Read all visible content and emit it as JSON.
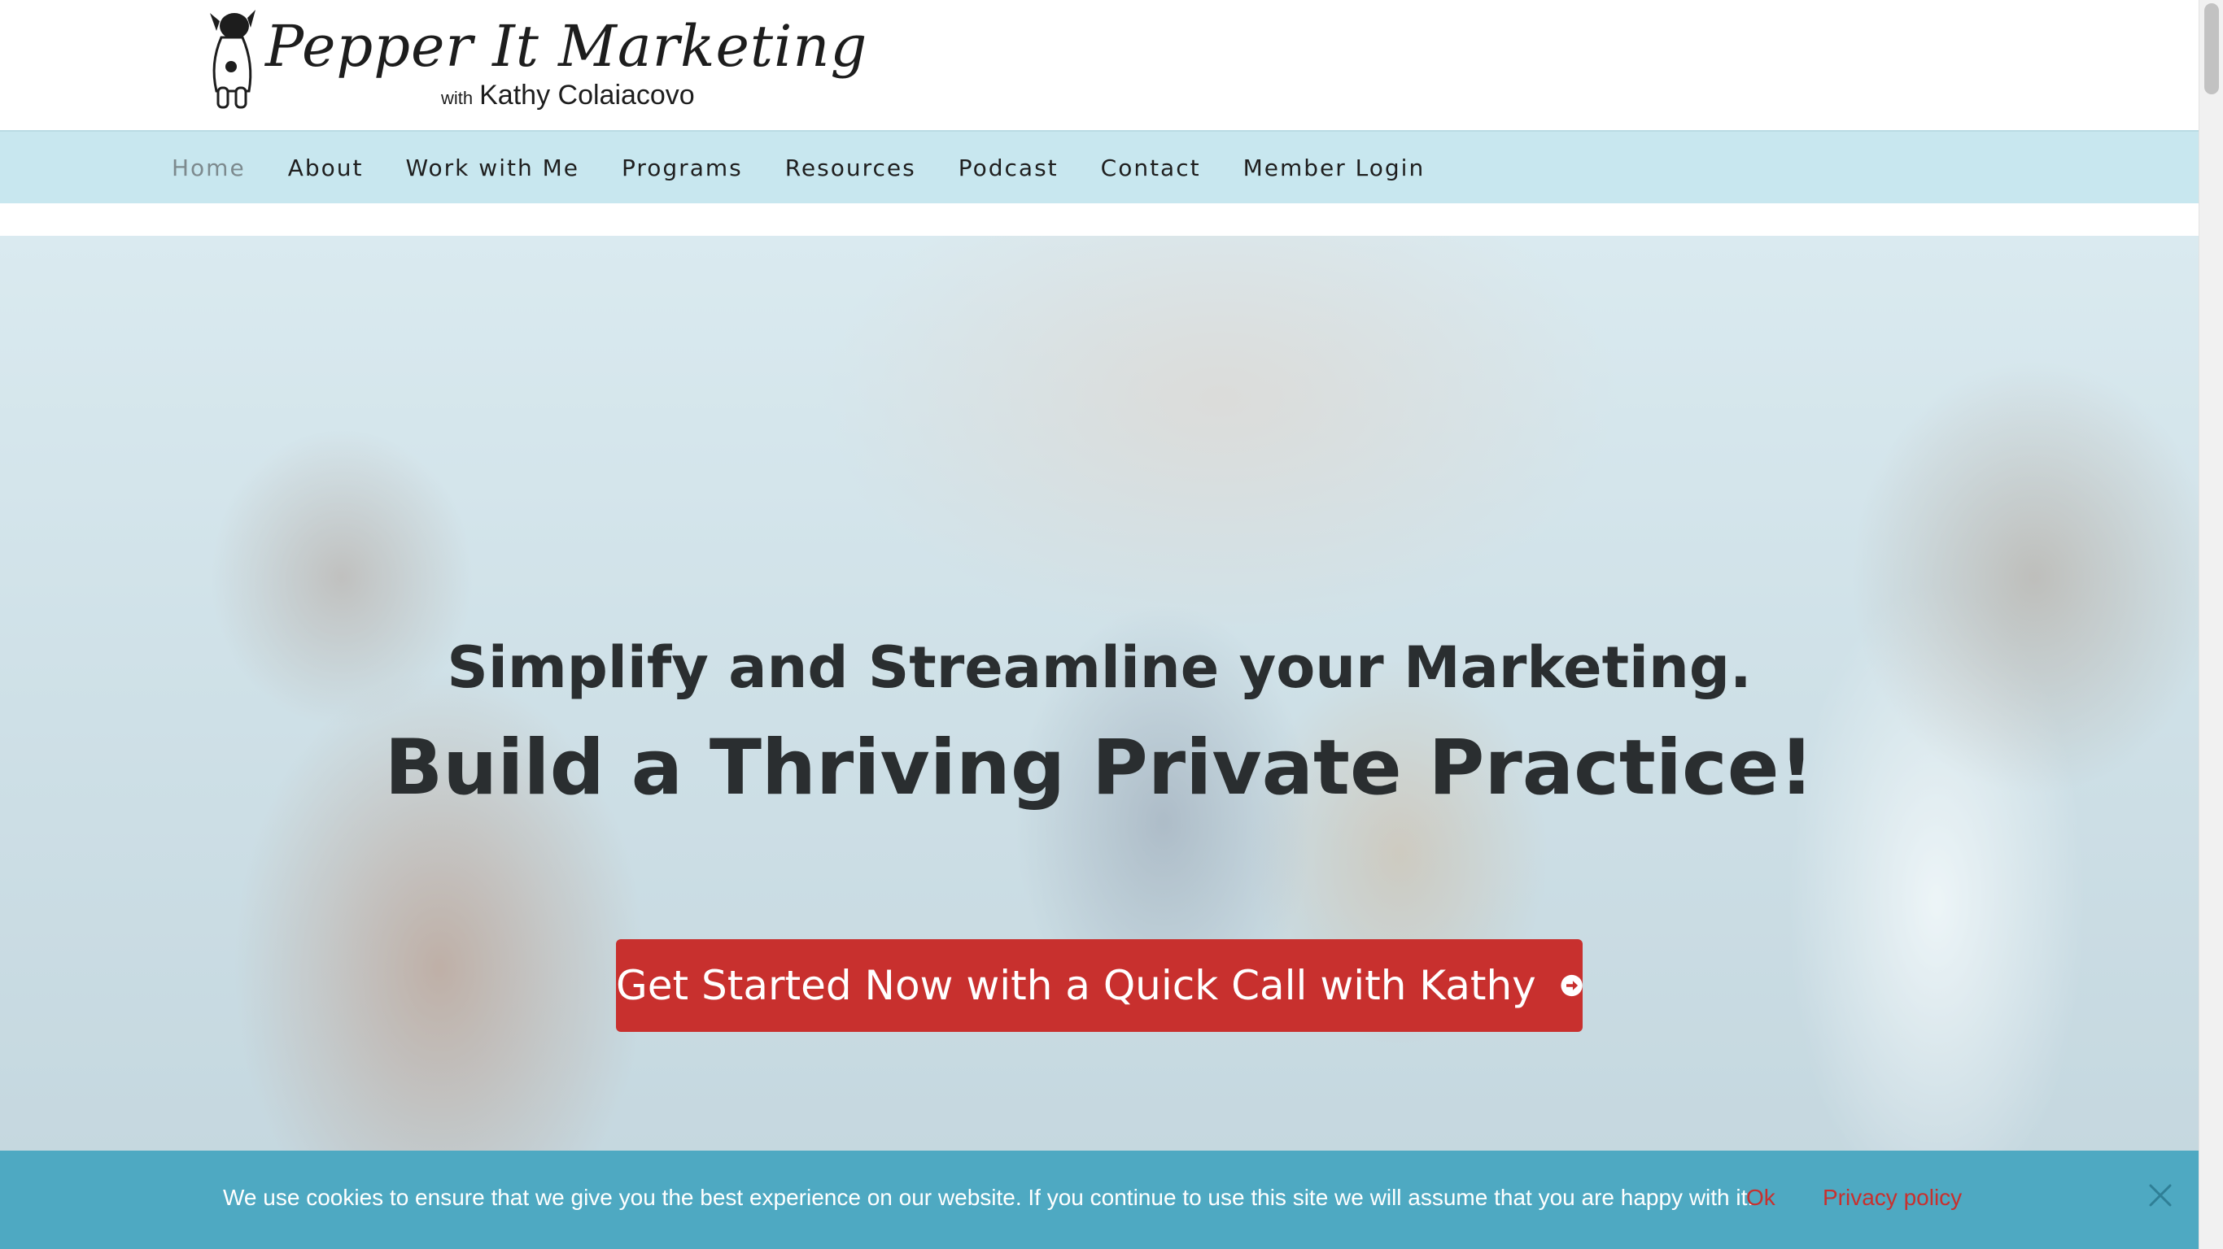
{
  "logo": {
    "script": "Pepper It Marketing",
    "with": "with",
    "name": "Kathy Colaiacovo",
    "icon": "dog-mascot-icon"
  },
  "nav": {
    "items": [
      {
        "label": "Home",
        "active": true
      },
      {
        "label": "About"
      },
      {
        "label": "Work with Me"
      },
      {
        "label": "Programs"
      },
      {
        "label": "Resources"
      },
      {
        "label": "Podcast"
      },
      {
        "label": "Contact"
      },
      {
        "label": "Member Login"
      }
    ]
  },
  "hero": {
    "headline": "Simplify and Streamline your Marketing.",
    "subheadline": "Build a Thriving Private Practice!",
    "cta_label": "Get Started Now with a Quick Call with Kathy",
    "cta_icon": "arrow-right-circle-icon"
  },
  "cookie": {
    "message": "We use cookies to ensure that we give you the best experience on our website. If you continue to use this site we will assume that you are happy with it.",
    "ok_label": "Ok",
    "privacy_label": "Privacy policy",
    "close_icon": "close-icon"
  },
  "colors": {
    "nav_bg": "#c8e7ef",
    "cta_bg": "#c8302e",
    "cookie_bg": "#4ea9c2",
    "link_red": "#c8302e"
  }
}
